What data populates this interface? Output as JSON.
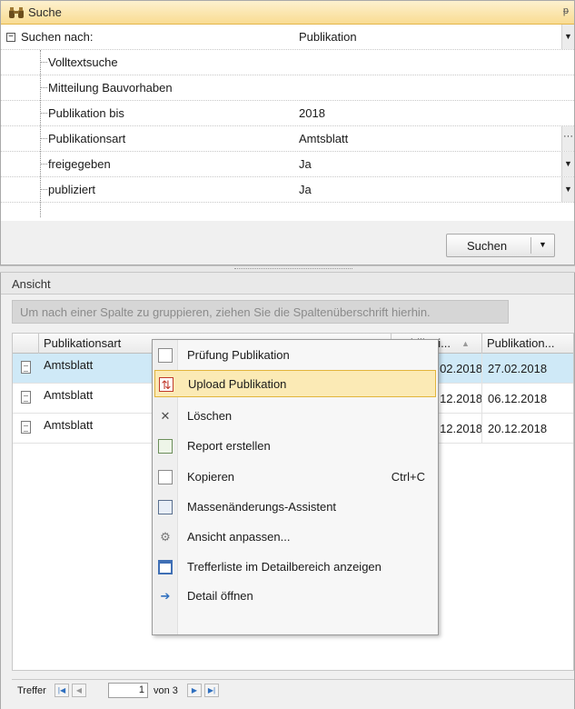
{
  "search": {
    "title": "Suche",
    "pin": "ᵽ",
    "rows": [
      {
        "label": "Suchen nach:",
        "value": "Publikation"
      },
      {
        "label": "Volltextsuche",
        "value": ""
      },
      {
        "label": "Mitteilung Bauvorhaben",
        "value": ""
      },
      {
        "label": "Publikation bis",
        "value": "2018"
      },
      {
        "label": "Publikationsart",
        "value": "Amtsblatt"
      },
      {
        "label": "freigegeben",
        "value": "Ja"
      },
      {
        "label": "publiziert",
        "value": "Ja"
      }
    ],
    "search_button": "Suchen"
  },
  "view": {
    "title": "Ansicht",
    "group_hint": "Um nach einer Spalte zu gruppieren, ziehen Sie die Spaltenüberschrift hierhin.",
    "columns": [
      "Publikationsart",
      "Publikati...",
      "Publikation..."
    ],
    "rows": [
      {
        "art": "Amtsblatt",
        "c2": "27.02.2018",
        "c3": "27.02.2018"
      },
      {
        "art": "Amtsblatt",
        "c2": "06.12.2018",
        "c3": "06.12.2018"
      },
      {
        "art": "Amtsblatt",
        "c2": "20.12.2018",
        "c3": "20.12.2018"
      }
    ],
    "footer": {
      "label": "Treffer",
      "page": "1",
      "of_label": "von 3"
    }
  },
  "context_menu": {
    "items": [
      {
        "label": "Prüfung Publikation",
        "icon": "document-check-icon"
      },
      {
        "label": "Upload Publikation",
        "icon": "upload-icon",
        "highlighted": true
      },
      {
        "label": "Löschen",
        "icon": "delete-x-icon"
      },
      {
        "label": "Report erstellen",
        "icon": "report-icon"
      },
      {
        "label": "Kopieren",
        "icon": "copy-icon",
        "shortcut": "Ctrl+C"
      },
      {
        "label": "Massenänderungs-Assistent",
        "icon": "mass-edit-icon"
      },
      {
        "label": "Ansicht anpassen...",
        "icon": "gear-icon"
      },
      {
        "label": "Trefferliste im Detailbereich anzeigen",
        "icon": "window-icon"
      },
      {
        "label": "Detail öffnen",
        "icon": "arrow-right-icon"
      }
    ]
  },
  "colors": {
    "title_bar": "#f9dc92",
    "selected_row": "#cfe9f7",
    "menu_highlight": "#fbeab5"
  }
}
